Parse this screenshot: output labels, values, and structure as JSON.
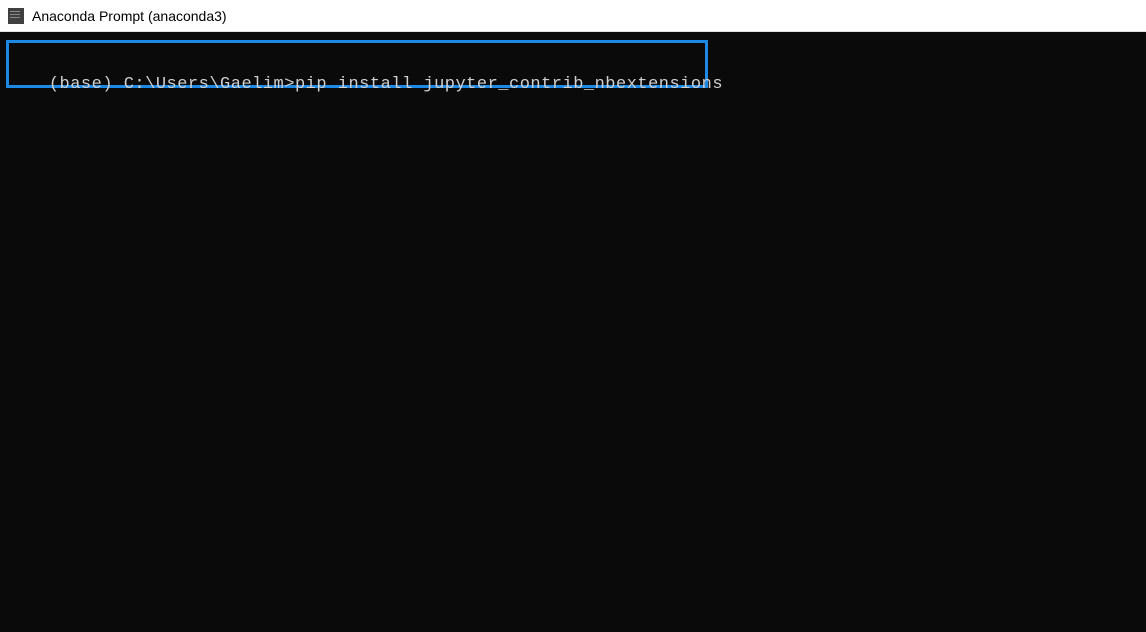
{
  "titlebar": {
    "title": "Anaconda Prompt (anaconda3)"
  },
  "terminal": {
    "prompt": "(base) C:\\Users\\Gaelim>",
    "command": "pip install jupyter_contrib_nbextensions"
  },
  "colors": {
    "highlight_border": "#1e88e5",
    "terminal_bg": "#0a0a0a",
    "terminal_fg": "#d0d0d0"
  }
}
